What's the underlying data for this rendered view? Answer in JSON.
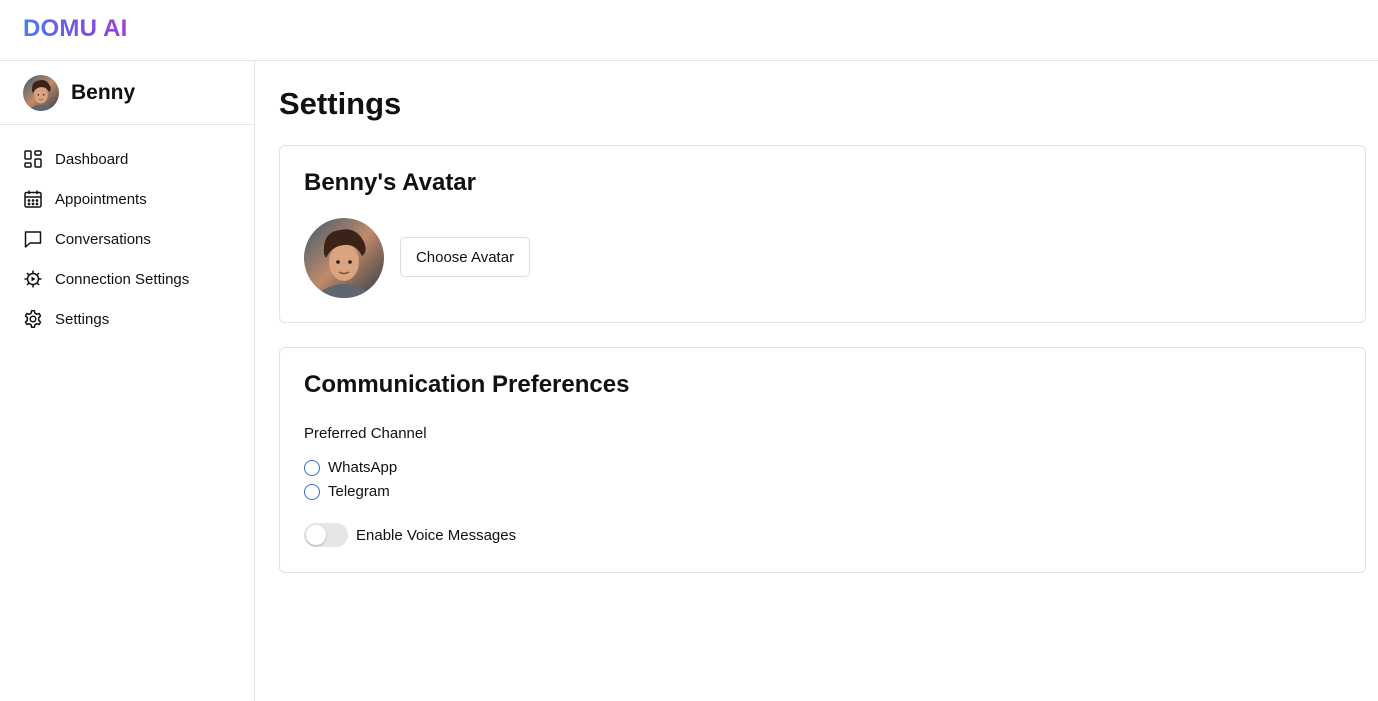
{
  "brand": {
    "name": "DOMU AI"
  },
  "user": {
    "name": "Benny"
  },
  "sidebar": {
    "items": [
      {
        "label": "Dashboard",
        "icon": "dashboard-icon"
      },
      {
        "label": "Appointments",
        "icon": "calendar-icon"
      },
      {
        "label": "Conversations",
        "icon": "chat-icon"
      },
      {
        "label": "Connection Settings",
        "icon": "gear-badge-icon"
      },
      {
        "label": "Settings",
        "icon": "gear-icon"
      }
    ]
  },
  "main": {
    "title": "Settings",
    "avatar_card": {
      "title": "Benny's Avatar",
      "choose_label": "Choose Avatar"
    },
    "comm_card": {
      "title": "Communication Preferences",
      "channel_label": "Preferred Channel",
      "options": [
        "WhatsApp",
        "Telegram"
      ],
      "voice_label": "Enable Voice Messages",
      "voice_enabled": false
    }
  },
  "colors": {
    "brand_start": "#4a7cf0",
    "brand_end": "#9b3ee0",
    "radio": "#2f6fd8",
    "border": "#e2e2e2"
  }
}
